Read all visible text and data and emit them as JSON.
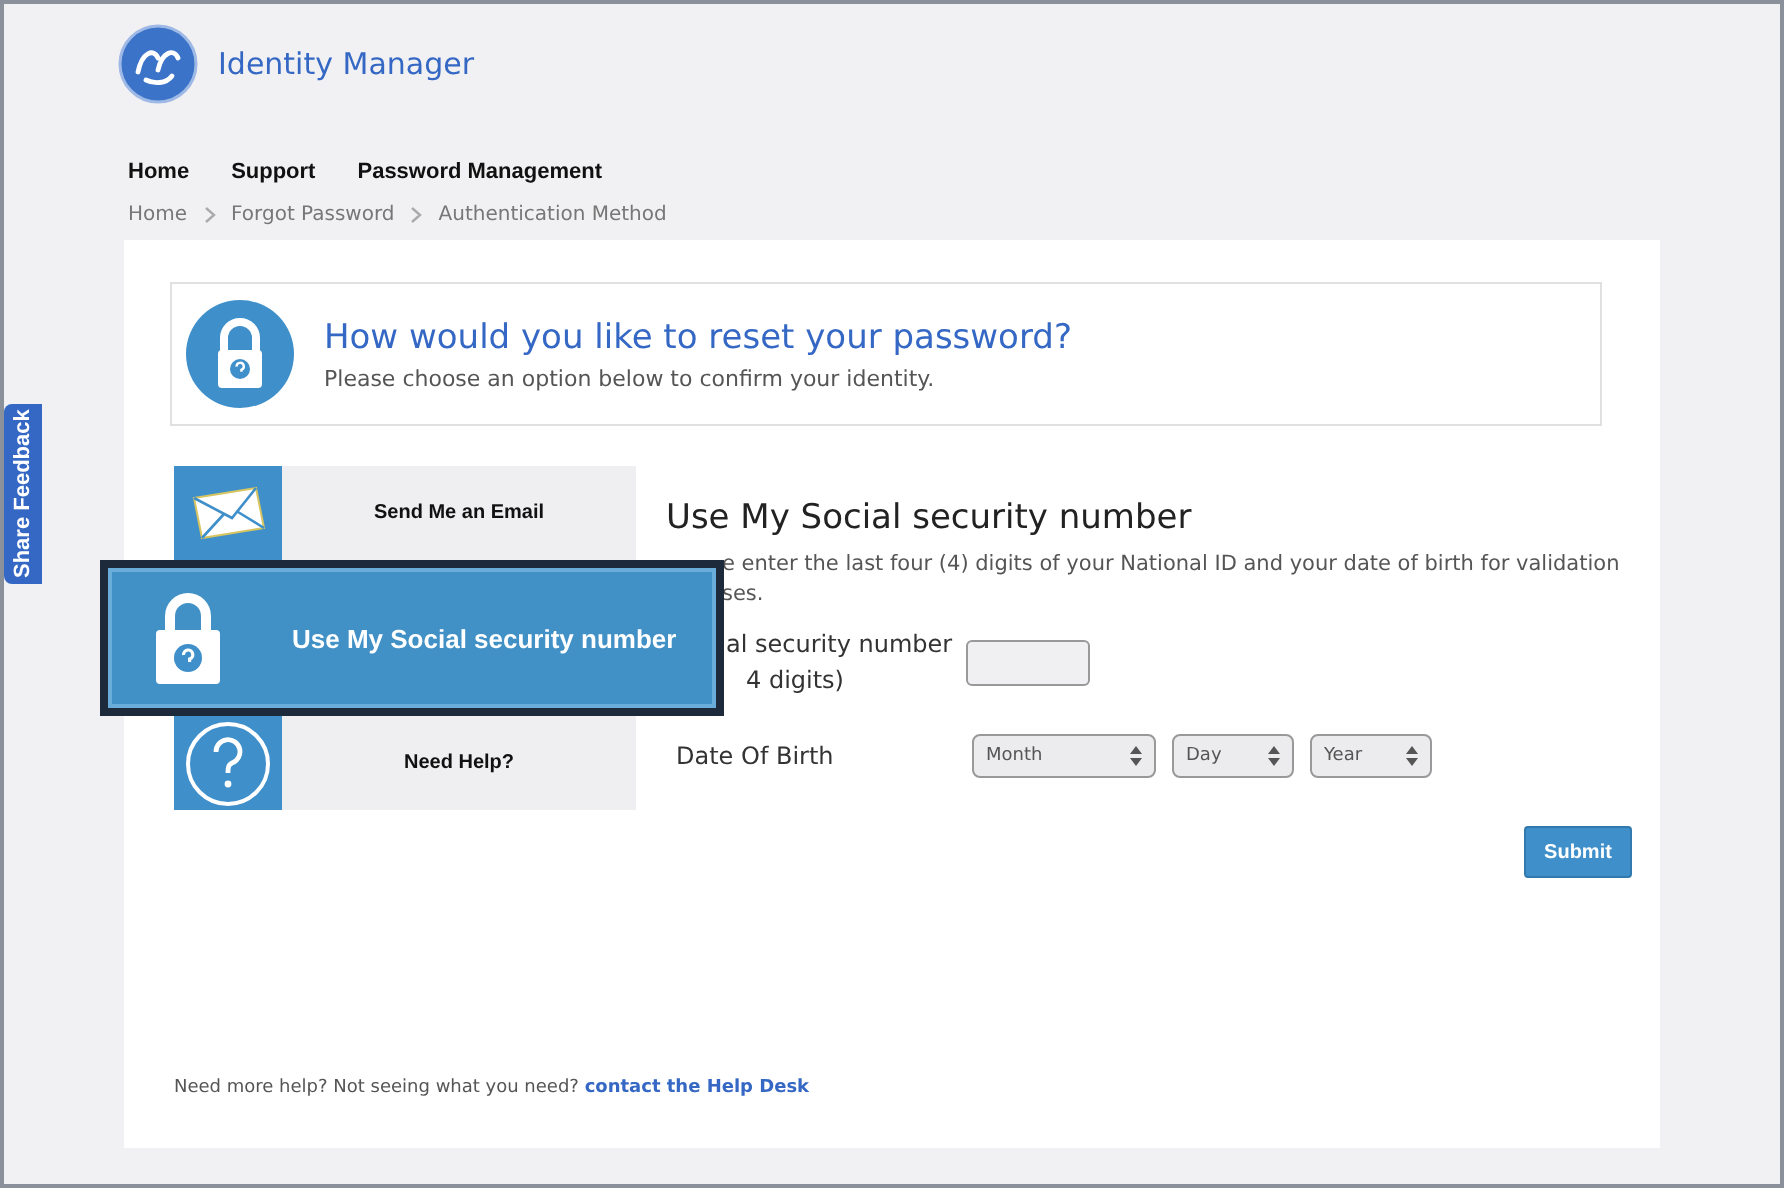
{
  "header": {
    "title": "Identity Manager"
  },
  "nav": [
    {
      "label": "Home"
    },
    {
      "label": "Support"
    },
    {
      "label": "Password Management"
    }
  ],
  "breadcrumb": [
    "Home",
    "Forgot Password",
    "Authentication Method"
  ],
  "feedback_tab": "Share Feedback",
  "intro": {
    "title": "How would you like to reset your password?",
    "subtitle": "Please choose an option below to confirm your identity."
  },
  "options": [
    {
      "kind": "email",
      "label": "Send Me an Email",
      "selected": false
    },
    {
      "kind": "lock",
      "label": "Use My Social security number",
      "selected": true
    },
    {
      "kind": "help",
      "label": "Need Help?",
      "selected": false
    }
  ],
  "form": {
    "title": "Use My Social security number",
    "description": [
      "e enter the last four (4) digits of your National ID and your date of birth for validation",
      "ses."
    ],
    "ssn_label": [
      "al security number",
      "4 digits)"
    ],
    "dob_label": "Date Of Birth",
    "selects": [
      {
        "placeholder": "Month"
      },
      {
        "placeholder": "Day"
      },
      {
        "placeholder": "Year"
      }
    ],
    "submit": "Submit"
  },
  "footer": {
    "text": "Need more help? Not seeing what you need?",
    "link": "contact the Help Desk"
  }
}
